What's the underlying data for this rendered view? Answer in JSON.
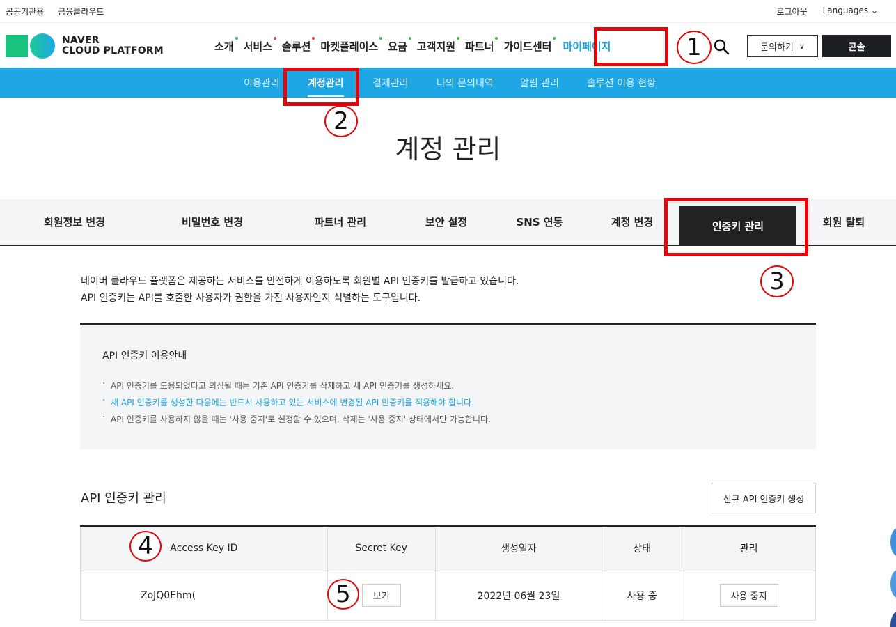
{
  "util": {
    "left": [
      "공공기관용",
      "금융클라우드"
    ],
    "logout": "로그아웃",
    "languages": "Languages"
  },
  "logo": {
    "line1": "NAVER",
    "line2": "CLOUD PLATFORM"
  },
  "gnb": [
    {
      "label": "소개",
      "dot": "#3bb54a"
    },
    {
      "label": "서비스",
      "dot": "#e0303a"
    },
    {
      "label": "솔루션",
      "dot": "#e0303a"
    },
    {
      "label": "마켓플레이스",
      "dot": "#3bb54a"
    },
    {
      "label": "요금",
      "dot": "#3bb54a"
    },
    {
      "label": "고객지원",
      "dot": "#3bb54a"
    },
    {
      "label": "파트너",
      "dot": "#3bb54a"
    },
    {
      "label": "가이드센터",
      "dot": "#3bb54a"
    },
    {
      "label": "마이페이지",
      "dot": ""
    }
  ],
  "header_buttons": {
    "inquiry": "문의하기",
    "console": "콘솔"
  },
  "subnav": [
    "이용관리",
    "계정관리",
    "결제관리",
    "나의 문의내역",
    "알림 관리",
    "솔루션 이용 현황"
  ],
  "page_title": "계정 관리",
  "tabs": [
    "회원정보 변경",
    "비밀번호 변경",
    "파트너 관리",
    "보안 설정",
    "SNS 연동",
    "계정 변경",
    "인증키 관리",
    "회원 탈퇴"
  ],
  "description": [
    "네이버 클라우드 플랫폼은 제공하는 서비스를 안전하게 이용하도록 회원별 API 인증키를 발급하고 있습니다.",
    "API 인증키는 API를 호출한 사용자가 권한을 가진 사용자인지 식별하는 도구입니다."
  ],
  "guide": {
    "title": "API 인증키 이용안내",
    "items": [
      "API 인증키를 도용되었다고 의심될 때는 기존 API 인증키를 삭제하고 새 API 인증키를 생성하세요.",
      "새 API 인증키를 생성한 다음에는 반드시 사용하고 있는 서비스에 변경된 API 인증키를 적용해야 합니다.",
      "API 인증키를 사용하지 않을 때는 '사용 중지'로 설정할 수 있으며, 삭제는 '사용 중지' 상태에서만 가능합니다."
    ]
  },
  "keys_section": {
    "title": "API 인증키 관리",
    "new_button": "신규 API 인증키 생성",
    "columns": [
      "Access Key ID",
      "Secret Key",
      "생성일자",
      "상태",
      "관리"
    ],
    "rows": [
      {
        "access_key": "ZoJQ0Ehm(",
        "secret_button": "보기",
        "created": "2022년 06월 23일",
        "status": "사용 중",
        "manage_button": "사용 중지"
      }
    ]
  },
  "annotations": [
    "1",
    "2",
    "3",
    "4",
    "5"
  ]
}
